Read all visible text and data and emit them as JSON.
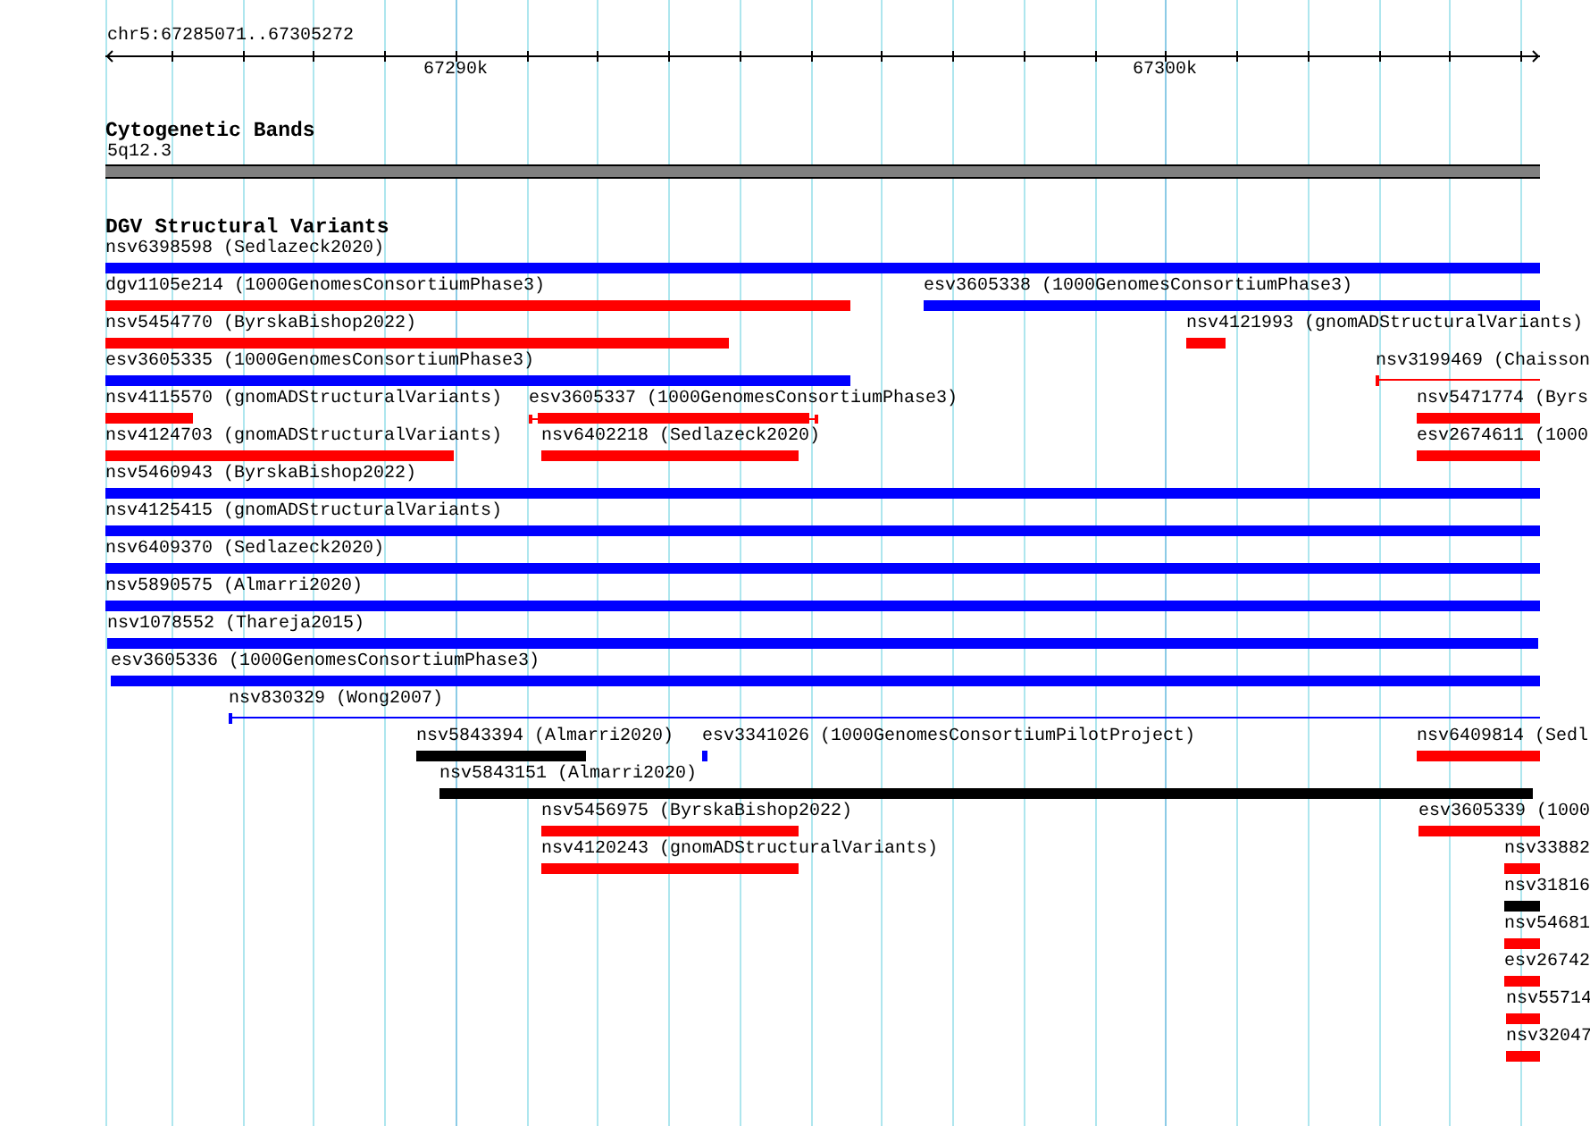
{
  "ruler": {
    "range": "chr5:67285071..67305272",
    "ticks": [
      "67290k",
      "67300k"
    ]
  },
  "cytogenetic_bands": {
    "title": "Cytogenetic Bands",
    "band": {
      "label": "5q12.3",
      "color": "#808080"
    }
  },
  "dgv": {
    "title": "DGV Structural Variants",
    "rows": [
      [
        {
          "label": "nsv6398598 (Sedlazeck2020)",
          "color": "#0000ff",
          "kind": "block"
        }
      ],
      [
        {
          "label": "dgv1105e214 (1000GenomesConsortiumPhase3)",
          "color": "#ff0000",
          "kind": "block"
        },
        {
          "label": "esv3605338 (1000GenomesConsortiumPhase3)",
          "color": "#0000ff",
          "kind": "block"
        }
      ],
      [
        {
          "label": "nsv5454770 (ByrskaBishop2022)",
          "color": "#ff0000",
          "kind": "block"
        },
        {
          "label": "nsv4121993 (gnomADStructuralVariants)",
          "color": "#ff0000",
          "kind": "block"
        }
      ],
      [
        {
          "label": "esv3605335 (1000GenomesConsortiumPhase3)",
          "color": "#0000ff",
          "kind": "block"
        },
        {
          "label": "nsv3199469 (Chaisson",
          "color": "#ff0000",
          "kind": "line"
        }
      ],
      [
        {
          "label": "nsv4115570 (gnomADStructuralVariants)",
          "color": "#ff0000",
          "kind": "block"
        },
        {
          "label": "esv3605337 (1000GenomesConsortiumPhase3)",
          "color": "#ff0000",
          "kind": "capped"
        },
        {
          "label": "nsv5471774 (Byrs",
          "color": "#ff0000",
          "kind": "block"
        }
      ],
      [
        {
          "label": "nsv4124703 (gnomADStructuralVariants)",
          "color": "#ff0000",
          "kind": "block"
        },
        {
          "label": "nsv6402218 (Sedlazeck2020)",
          "color": "#ff0000",
          "kind": "block"
        },
        {
          "label": "esv2674611 (1000",
          "color": "#ff0000",
          "kind": "block"
        }
      ],
      [
        {
          "label": "nsv5460943 (ByrskaBishop2022)",
          "color": "#0000ff",
          "kind": "block"
        }
      ],
      [
        {
          "label": "nsv4125415 (gnomADStructuralVariants)",
          "color": "#0000ff",
          "kind": "block"
        }
      ],
      [
        {
          "label": "nsv6409370 (Sedlazeck2020)",
          "color": "#0000ff",
          "kind": "block"
        }
      ],
      [
        {
          "label": "nsv5890575 (Almarri2020)",
          "color": "#0000ff",
          "kind": "block"
        }
      ],
      [
        {
          "label": "nsv1078552 (Thareja2015)",
          "color": "#0000ff",
          "kind": "block"
        }
      ],
      [
        {
          "label": "esv3605336 (1000GenomesConsortiumPhase3)",
          "color": "#0000ff",
          "kind": "block"
        }
      ],
      [
        {
          "label": "nsv830329 (Wong2007)",
          "color": "#0000ff",
          "kind": "line"
        }
      ],
      [
        {
          "label": "nsv5843394 (Almarri2020)",
          "color": "#000000",
          "kind": "block"
        },
        {
          "label": "esv3341026 (1000GenomesConsortiumPilotProject)",
          "color": "#0000ff",
          "kind": "block"
        },
        {
          "label": "nsv6409814 (Sedl",
          "color": "#ff0000",
          "kind": "block"
        }
      ],
      [
        {
          "label": "nsv5843151 (Almarri2020)",
          "color": "#000000",
          "kind": "block"
        }
      ],
      [
        {
          "label": "nsv5456975 (ByrskaBishop2022)",
          "color": "#ff0000",
          "kind": "block"
        },
        {
          "label": "esv3605339 (1000",
          "color": "#ff0000",
          "kind": "block"
        }
      ],
      [
        {
          "label": "nsv4120243 (gnomADStructuralVariants)",
          "color": "#ff0000",
          "kind": "block"
        },
        {
          "label": "nsv33882",
          "color": "#ff0000",
          "kind": "block"
        }
      ],
      [
        {
          "label": "nsv31816",
          "color": "#000000",
          "kind": "block"
        }
      ],
      [
        {
          "label": "nsv54681",
          "color": "#ff0000",
          "kind": "block"
        }
      ],
      [
        {
          "label": "esv26742",
          "color": "#ff0000",
          "kind": "block"
        }
      ],
      [
        {
          "label": "nsv55714",
          "color": "#ff0000",
          "kind": "block"
        }
      ],
      [
        {
          "label": "nsv32047",
          "color": "#ff0000",
          "kind": "block"
        }
      ]
    ]
  }
}
